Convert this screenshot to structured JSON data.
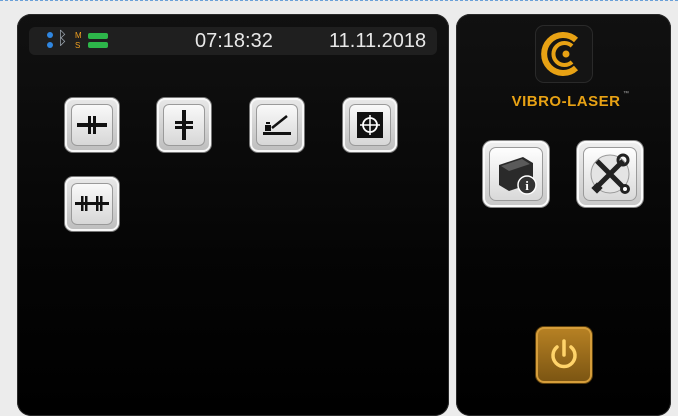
{
  "status_bar": {
    "ms_label_top": "M",
    "ms_label_bottom": "S",
    "time": "07:18:32",
    "date": "11.11.2018"
  },
  "brand": {
    "name": "VIBRO-LASER",
    "trademark": "™"
  },
  "icons": {
    "bluetooth": "bluetooth-icon",
    "battery": "battery-level-icon",
    "horizontal_shaft": "horizontal-shaft-alignment-icon",
    "vertical_shaft": "vertical-shaft-alignment-icon",
    "flatness": "flatness-measurement-icon",
    "target": "target-crosshair-icon",
    "train": "machine-train-alignment-icon",
    "device_info": "device-info-icon",
    "settings": "tools-settings-icon",
    "power": "power-icon",
    "logo": "vibro-laser-logo-icon"
  },
  "colors": {
    "accent": "#e8a214",
    "bluetooth": "#2f86e0",
    "battery": "#2db64a",
    "panel": "#0a0a0a"
  }
}
